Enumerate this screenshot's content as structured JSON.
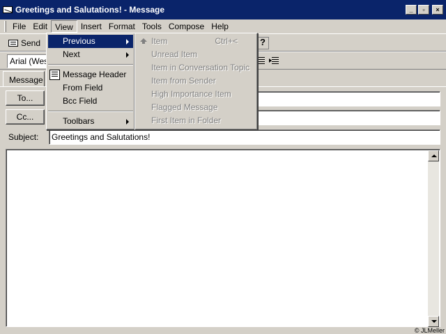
{
  "window": {
    "title": "Greetings and Salutations! - Message",
    "min_glyph": "_",
    "max_glyph": "▫",
    "close_glyph": "×"
  },
  "menubar": {
    "items": [
      "File",
      "Edit",
      "View",
      "Insert",
      "Format",
      "Tools",
      "Compose",
      "Help"
    ]
  },
  "toolbar": {
    "send_label": "Send",
    "font_name": "Arial (West"
  },
  "tabs": {
    "message": "Message"
  },
  "fields": {
    "to_label": "To...",
    "cc_label": "Cc...",
    "subject_label": "Subject:",
    "to_value": "",
    "cc_value": "",
    "subject_value": "Greetings and Salutations!"
  },
  "view_menu": {
    "items": [
      "Previous",
      "Next",
      "Message Header",
      "From Field",
      "Bcc Field",
      "Toolbars"
    ]
  },
  "previous_submenu": {
    "items": [
      {
        "label": "Item",
        "shortcut": "Ctrl+<"
      },
      {
        "label": "Unread Item",
        "shortcut": ""
      },
      {
        "label": "Item in Conversation Topic",
        "shortcut": ""
      },
      {
        "label": "Item from Sender",
        "shortcut": ""
      },
      {
        "label": "High Importance Item",
        "shortcut": ""
      },
      {
        "label": "Flagged Message",
        "shortcut": ""
      },
      {
        "label": "First Item in Folder",
        "shortcut": ""
      }
    ]
  },
  "footer": {
    "copyright": "© JLMeller"
  },
  "colors": {
    "titlebar": "#0a246a",
    "face": "#d4d0c8",
    "highlight": "#0a246a"
  }
}
